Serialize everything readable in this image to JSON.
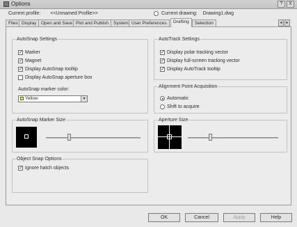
{
  "window": {
    "title": "Options",
    "help_btn": "?",
    "close_btn": "X"
  },
  "header": {
    "current_profile_label": "Current profile:",
    "current_profile_value": "<<Unnamed Profile>>",
    "current_drawing_label": "Current drawing:",
    "current_drawing_value": "Drawing1.dwg"
  },
  "tabs": [
    "Files",
    "Display",
    "Open and Save",
    "Plot and Publish",
    "System",
    "User Preferences",
    "Drafting",
    "Selection"
  ],
  "tab_scroll": {
    "left": "◂",
    "right": "▸"
  },
  "active_tab": "Drafting",
  "autosnap": {
    "legend": "AutoSnap Settings",
    "options": [
      {
        "label": "Marker",
        "checked": true
      },
      {
        "label": "Magnet",
        "checked": true
      },
      {
        "label": "Display AutoSnap tooltip",
        "checked": true
      },
      {
        "label": "Display AutoSnap aperture box",
        "checked": false
      }
    ],
    "color_label": "AutoSnap marker color:",
    "color_value": "Yellow",
    "color_swatch": "#ffff00"
  },
  "autotrack": {
    "legend": "AutoTrack Settings",
    "options": [
      {
        "label": "Display polar tracking vector",
        "checked": true
      },
      {
        "label": "Display full-screen tracking vector",
        "checked": true
      },
      {
        "label": "Display AutoTrack tooltip",
        "checked": true
      }
    ]
  },
  "alignment": {
    "legend": "Alignment Point Acquisition",
    "options": [
      {
        "label": "Automatic",
        "selected": true
      },
      {
        "label": "Shift to acquire",
        "selected": false
      }
    ]
  },
  "marker_size": {
    "legend": "AutoSnap Marker Size",
    "level": 0.25
  },
  "aperture_size": {
    "legend": "Aperture Size",
    "level": 0.25
  },
  "object_snap": {
    "legend": "Object Snap Options",
    "options": [
      {
        "label": "Ignore hatch objects",
        "checked": true
      }
    ]
  },
  "buttons": {
    "ok": "OK",
    "cancel": "Cancel",
    "apply": "Apply",
    "help": "Help"
  },
  "check_mark": "✓"
}
